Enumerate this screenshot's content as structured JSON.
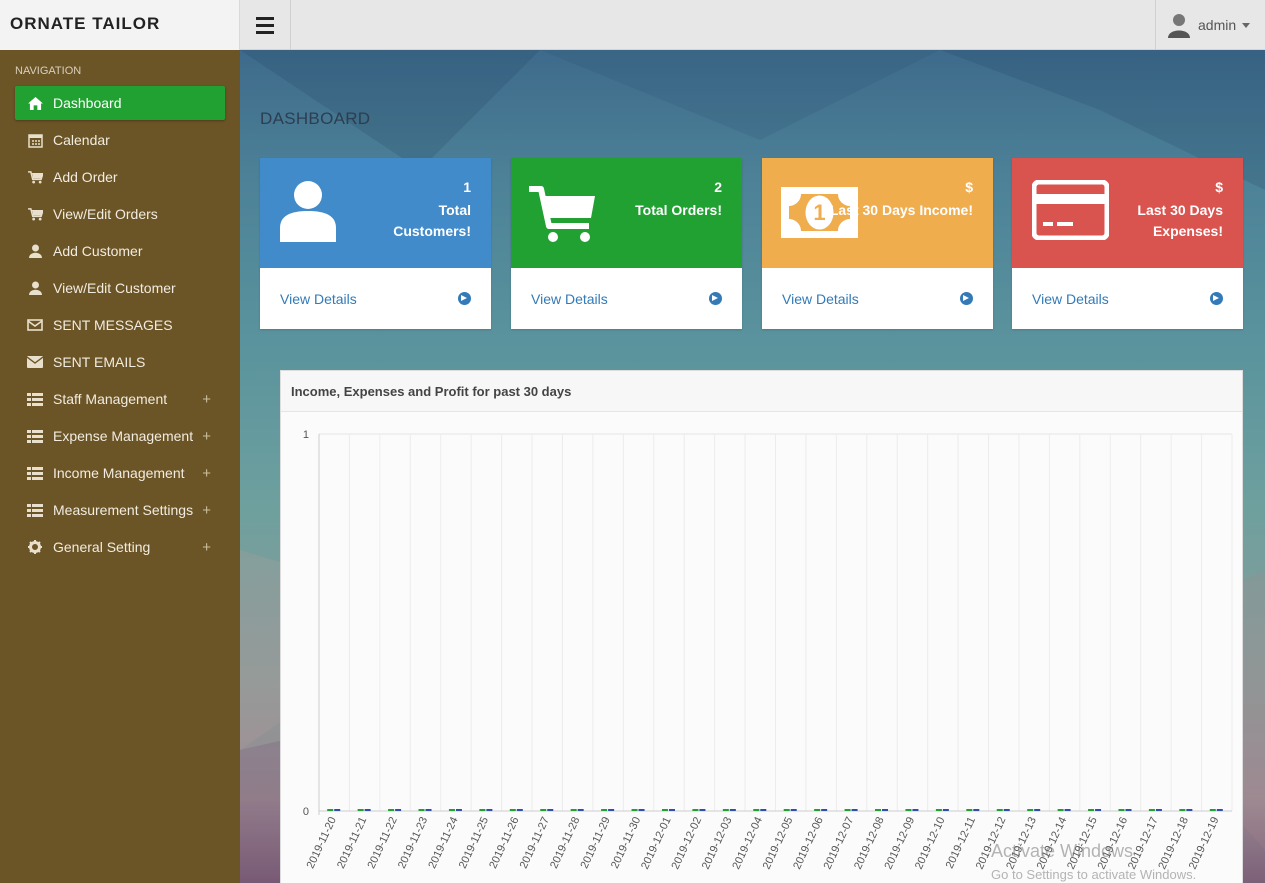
{
  "app": {
    "brand": "ORNATE TAILOR",
    "user": "admin"
  },
  "sidebar": {
    "heading": "NAVIGATION",
    "items": [
      {
        "label": "Dashboard",
        "icon": "home-icon",
        "active": true,
        "expandable": false
      },
      {
        "label": "Calendar",
        "icon": "calendar-icon",
        "active": false,
        "expandable": false
      },
      {
        "label": "Add Order",
        "icon": "cart-icon",
        "active": false,
        "expandable": false
      },
      {
        "label": "View/Edit Orders",
        "icon": "cart-icon",
        "active": false,
        "expandable": false
      },
      {
        "label": "Add Customer",
        "icon": "user-icon",
        "active": false,
        "expandable": false
      },
      {
        "label": "View/Edit Customer",
        "icon": "user-icon",
        "active": false,
        "expandable": false
      },
      {
        "label": "SENT MESSAGES",
        "icon": "envelope-outline-icon",
        "active": false,
        "expandable": false
      },
      {
        "label": "SENT EMAILS",
        "icon": "envelope-icon",
        "active": false,
        "expandable": false
      },
      {
        "label": "Staff Management",
        "icon": "list-icon",
        "active": false,
        "expandable": true
      },
      {
        "label": "Expense Management",
        "icon": "list-icon",
        "active": false,
        "expandable": true
      },
      {
        "label": "Income Management",
        "icon": "list-icon",
        "active": false,
        "expandable": true
      },
      {
        "label": "Measurement Settings",
        "icon": "list-icon",
        "active": false,
        "expandable": true
      },
      {
        "label": "General Setting",
        "icon": "gear-icon",
        "active": false,
        "expandable": true
      }
    ],
    "expand_symbol": "+"
  },
  "page": {
    "title": "DASHBOARD"
  },
  "cards": [
    {
      "value": "1",
      "label": "Total Customers!",
      "link": "View Details",
      "color": "#428bca",
      "icon": "user-icon"
    },
    {
      "value": "2",
      "label": "Total Orders!",
      "link": "View Details",
      "color": "#21a132",
      "icon": "cart-icon"
    },
    {
      "value": "$",
      "label": "Last 30 Days Income!",
      "link": "View Details",
      "color": "#f0ad4e",
      "icon": "money-icon"
    },
    {
      "value": "$",
      "label": "Last 30 Days Expenses!",
      "link": "View Details",
      "color": "#d9534f",
      "icon": "credit-card-icon"
    }
  ],
  "panel": {
    "title": "Income, Expenses and Profit for past 30 days"
  },
  "chart_data": {
    "type": "bar",
    "categories": [
      "2019-11-20",
      "2019-11-21",
      "2019-11-22",
      "2019-11-23",
      "2019-11-24",
      "2019-11-25",
      "2019-11-26",
      "2019-11-27",
      "2019-11-28",
      "2019-11-29",
      "2019-11-30",
      "2019-12-01",
      "2019-12-02",
      "2019-12-03",
      "2019-12-04",
      "2019-12-05",
      "2019-12-06",
      "2019-12-07",
      "2019-12-08",
      "2019-12-09",
      "2019-12-10",
      "2019-12-11",
      "2019-12-12",
      "2019-12-13",
      "2019-12-14",
      "2019-12-15",
      "2019-12-16",
      "2019-12-17",
      "2019-12-18",
      "2019-12-19"
    ],
    "series": [
      {
        "values": [
          0,
          0,
          0,
          0,
          0,
          0,
          0,
          0,
          0,
          0,
          0,
          0,
          0,
          0,
          0,
          0,
          0,
          0,
          0,
          0,
          0,
          0,
          0,
          0,
          0,
          0,
          0,
          0,
          0,
          0
        ],
        "color": "#21a132"
      },
      {
        "values": [
          0,
          0,
          0,
          0,
          0,
          0,
          0,
          0,
          0,
          0,
          0,
          0,
          0,
          0,
          0,
          0,
          0,
          0,
          0,
          0,
          0,
          0,
          0,
          0,
          0,
          0,
          0,
          0,
          0,
          0
        ],
        "color": "#2f4fb0"
      }
    ],
    "yticks": [
      "0",
      "1"
    ],
    "ylim": [
      0,
      1
    ],
    "grid": true,
    "legend": "none"
  },
  "watermark": {
    "line1": "Activate Windows",
    "line2": "Go to Settings to activate Windows."
  }
}
